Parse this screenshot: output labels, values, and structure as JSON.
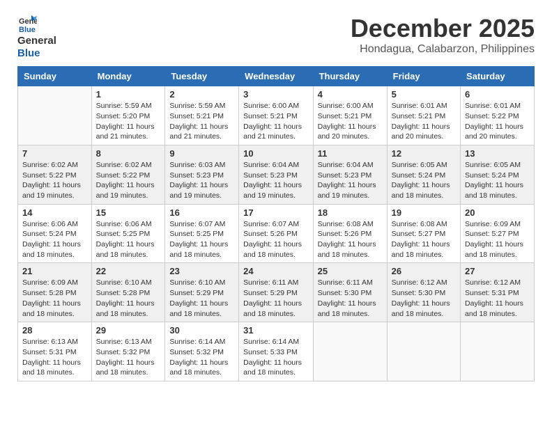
{
  "header": {
    "logo_line1": "General",
    "logo_line2": "Blue",
    "month": "December 2025",
    "location": "Hondagua, Calabarzon, Philippines"
  },
  "weekdays": [
    "Sunday",
    "Monday",
    "Tuesday",
    "Wednesday",
    "Thursday",
    "Friday",
    "Saturday"
  ],
  "weeks": [
    [
      {
        "day": "",
        "info": ""
      },
      {
        "day": "1",
        "info": "Sunrise: 5:59 AM\nSunset: 5:20 PM\nDaylight: 11 hours\nand 21 minutes."
      },
      {
        "day": "2",
        "info": "Sunrise: 5:59 AM\nSunset: 5:21 PM\nDaylight: 11 hours\nand 21 minutes."
      },
      {
        "day": "3",
        "info": "Sunrise: 6:00 AM\nSunset: 5:21 PM\nDaylight: 11 hours\nand 21 minutes."
      },
      {
        "day": "4",
        "info": "Sunrise: 6:00 AM\nSunset: 5:21 PM\nDaylight: 11 hours\nand 20 minutes."
      },
      {
        "day": "5",
        "info": "Sunrise: 6:01 AM\nSunset: 5:21 PM\nDaylight: 11 hours\nand 20 minutes."
      },
      {
        "day": "6",
        "info": "Sunrise: 6:01 AM\nSunset: 5:22 PM\nDaylight: 11 hours\nand 20 minutes."
      }
    ],
    [
      {
        "day": "7",
        "info": "Sunrise: 6:02 AM\nSunset: 5:22 PM\nDaylight: 11 hours\nand 19 minutes."
      },
      {
        "day": "8",
        "info": "Sunrise: 6:02 AM\nSunset: 5:22 PM\nDaylight: 11 hours\nand 19 minutes."
      },
      {
        "day": "9",
        "info": "Sunrise: 6:03 AM\nSunset: 5:23 PM\nDaylight: 11 hours\nand 19 minutes."
      },
      {
        "day": "10",
        "info": "Sunrise: 6:04 AM\nSunset: 5:23 PM\nDaylight: 11 hours\nand 19 minutes."
      },
      {
        "day": "11",
        "info": "Sunrise: 6:04 AM\nSunset: 5:23 PM\nDaylight: 11 hours\nand 19 minutes."
      },
      {
        "day": "12",
        "info": "Sunrise: 6:05 AM\nSunset: 5:24 PM\nDaylight: 11 hours\nand 18 minutes."
      },
      {
        "day": "13",
        "info": "Sunrise: 6:05 AM\nSunset: 5:24 PM\nDaylight: 11 hours\nand 18 minutes."
      }
    ],
    [
      {
        "day": "14",
        "info": "Sunrise: 6:06 AM\nSunset: 5:24 PM\nDaylight: 11 hours\nand 18 minutes."
      },
      {
        "day": "15",
        "info": "Sunrise: 6:06 AM\nSunset: 5:25 PM\nDaylight: 11 hours\nand 18 minutes."
      },
      {
        "day": "16",
        "info": "Sunrise: 6:07 AM\nSunset: 5:25 PM\nDaylight: 11 hours\nand 18 minutes."
      },
      {
        "day": "17",
        "info": "Sunrise: 6:07 AM\nSunset: 5:26 PM\nDaylight: 11 hours\nand 18 minutes."
      },
      {
        "day": "18",
        "info": "Sunrise: 6:08 AM\nSunset: 5:26 PM\nDaylight: 11 hours\nand 18 minutes."
      },
      {
        "day": "19",
        "info": "Sunrise: 6:08 AM\nSunset: 5:27 PM\nDaylight: 11 hours\nand 18 minutes."
      },
      {
        "day": "20",
        "info": "Sunrise: 6:09 AM\nSunset: 5:27 PM\nDaylight: 11 hours\nand 18 minutes."
      }
    ],
    [
      {
        "day": "21",
        "info": "Sunrise: 6:09 AM\nSunset: 5:28 PM\nDaylight: 11 hours\nand 18 minutes."
      },
      {
        "day": "22",
        "info": "Sunrise: 6:10 AM\nSunset: 5:28 PM\nDaylight: 11 hours\nand 18 minutes."
      },
      {
        "day": "23",
        "info": "Sunrise: 6:10 AM\nSunset: 5:29 PM\nDaylight: 11 hours\nand 18 minutes."
      },
      {
        "day": "24",
        "info": "Sunrise: 6:11 AM\nSunset: 5:29 PM\nDaylight: 11 hours\nand 18 minutes."
      },
      {
        "day": "25",
        "info": "Sunrise: 6:11 AM\nSunset: 5:30 PM\nDaylight: 11 hours\nand 18 minutes."
      },
      {
        "day": "26",
        "info": "Sunrise: 6:12 AM\nSunset: 5:30 PM\nDaylight: 11 hours\nand 18 minutes."
      },
      {
        "day": "27",
        "info": "Sunrise: 6:12 AM\nSunset: 5:31 PM\nDaylight: 11 hours\nand 18 minutes."
      }
    ],
    [
      {
        "day": "28",
        "info": "Sunrise: 6:13 AM\nSunset: 5:31 PM\nDaylight: 11 hours\nand 18 minutes."
      },
      {
        "day": "29",
        "info": "Sunrise: 6:13 AM\nSunset: 5:32 PM\nDaylight: 11 hours\nand 18 minutes."
      },
      {
        "day": "30",
        "info": "Sunrise: 6:14 AM\nSunset: 5:32 PM\nDaylight: 11 hours\nand 18 minutes."
      },
      {
        "day": "31",
        "info": "Sunrise: 6:14 AM\nSunset: 5:33 PM\nDaylight: 11 hours\nand 18 minutes."
      },
      {
        "day": "",
        "info": ""
      },
      {
        "day": "",
        "info": ""
      },
      {
        "day": "",
        "info": ""
      }
    ]
  ]
}
